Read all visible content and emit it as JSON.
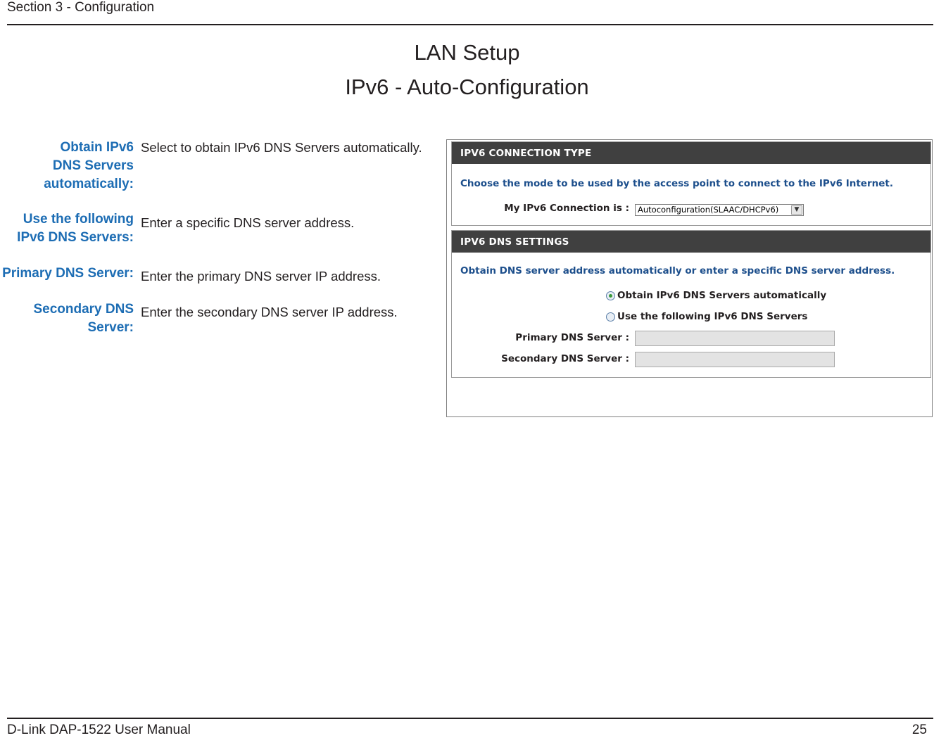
{
  "header": {
    "section": "Section 3 - Configuration"
  },
  "titles": {
    "main": "LAN Setup",
    "sub": "IPv6 - Auto-Configuration"
  },
  "definitions": [
    {
      "term_lines": [
        "Obtain IPv6",
        "DNS Servers",
        "automatically:"
      ],
      "description": "Select to obtain IPv6 DNS Servers automatically."
    },
    {
      "term_lines": [
        "Use the following",
        "IPv6 DNS Servers:"
      ],
      "description": "Enter a specific DNS server address."
    },
    {
      "term_lines": [
        "Primary DNS Server:"
      ],
      "description": "Enter the primary DNS server IP address."
    },
    {
      "term_lines": [
        "Secondary DNS",
        "Server:"
      ],
      "description": "Enter the secondary DNS server IP address."
    }
  ],
  "ui": {
    "connection_type": {
      "header": "IPV6 CONNECTION TYPE",
      "description": "Choose the mode to be used by the access point to connect to the IPv6 Internet.",
      "field_label": "My IPv6 Connection is :",
      "selected_value": "Autoconfiguration(SLAAC/DHCPv6)"
    },
    "dns_settings": {
      "header": "IPV6 DNS SETTINGS",
      "description": "Obtain DNS server address automatically or enter a specific DNS server address.",
      "radio_auto": "Obtain IPv6 DNS Servers automatically",
      "radio_manual": "Use the following IPv6 DNS Servers",
      "radio_auto_selected": true,
      "primary_label": "Primary DNS Server :",
      "secondary_label": "Secondary DNS Server :"
    }
  },
  "footer": {
    "manual": "D-Link DAP-1522 User Manual",
    "page": "25"
  },
  "colors": {
    "term_blue": "#1d6db4",
    "panel_header": "#404040",
    "ui_blue_text": "#1d4f8c"
  }
}
